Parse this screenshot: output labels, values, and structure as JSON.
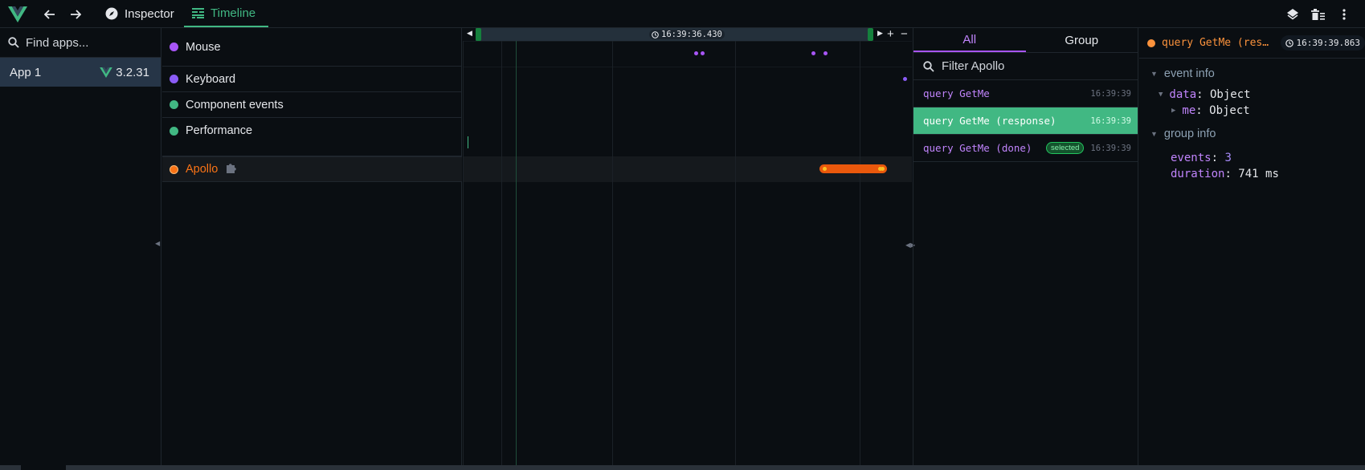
{
  "topbar": {
    "tabs": [
      {
        "label": "Inspector",
        "icon": "compass-icon",
        "active": false
      },
      {
        "label": "Timeline",
        "icon": "timeline-icon",
        "active": true
      }
    ],
    "right_icons": [
      "layers-icon",
      "clear-icon",
      "more-vert-icon"
    ]
  },
  "apps": {
    "search_placeholder": "Find apps...",
    "items": [
      {
        "name": "App 1",
        "version": "3.2.31",
        "selected": true
      }
    ]
  },
  "layers": [
    {
      "label": "Mouse",
      "color": "#a855f7"
    },
    {
      "label": "Keyboard",
      "color": "#8b5cf6"
    },
    {
      "label": "Component events",
      "color": "#41b883"
    },
    {
      "label": "Performance",
      "color": "#41b883"
    },
    {
      "label": "Apollo",
      "color": "#f97316",
      "highlighted": true,
      "plugin_icon": "puzzle-icon"
    }
  ],
  "timeline": {
    "current_time": "16:39:36.430",
    "zoom_in": "+",
    "zoom_out": "−"
  },
  "events": {
    "tabs": [
      {
        "label": "All",
        "active": true
      },
      {
        "label": "Group",
        "active": false
      }
    ],
    "filter_placeholder": "Filter Apollo",
    "rows": [
      {
        "title": "query GetMe",
        "time": "16:39:39",
        "selected": false,
        "badge": ""
      },
      {
        "title": "query GetMe (response)",
        "time": "16:39:39",
        "selected": true,
        "badge": ""
      },
      {
        "title": "query GetMe (done)",
        "time": "16:39:39",
        "selected": false,
        "badge": "selected"
      }
    ]
  },
  "details": {
    "title": "query GetMe (res…",
    "time": "16:39:39.863",
    "event_info": {
      "label": "event info",
      "data_key": "data",
      "data_value": "Object",
      "me_key": "me",
      "me_value": "Object"
    },
    "group_info": {
      "label": "group info",
      "events_key": "events",
      "events_value": "3",
      "duration_key": "duration",
      "duration_value": "741 ms"
    }
  }
}
